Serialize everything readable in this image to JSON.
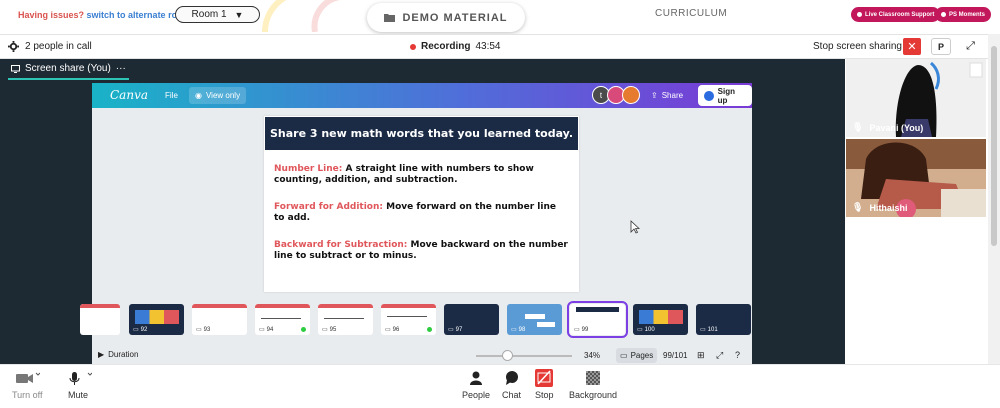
{
  "topbar": {
    "issues_text": "Having issues?",
    "alt_room_link": "switch to alternate room",
    "room_select": "Room 1",
    "demo_material": "DEMO MATERIAL",
    "curriculum": "CURRICULUM",
    "live_support": "Live Classroom Support",
    "ps_moments": "PS Moments",
    "brand_color": "#c2185b"
  },
  "callbar": {
    "people_count": "2 people in call",
    "recording_label": "Recording",
    "recording_time": "43:54",
    "stop_sharing": "Stop screen sharing",
    "p_label": "P"
  },
  "stage": {
    "share_tab": "Screen share (You)",
    "more": "···"
  },
  "canva": {
    "logo": "Canva",
    "file": "File",
    "view_only": "View only",
    "avatar_initial": "t",
    "share": "Share",
    "sign_up": "Sign up",
    "slide": {
      "title": "Share 3 new math words that you learned today.",
      "items": [
        {
          "term": "Number Line:",
          "text": "A straight line with numbers to show counting, addition, and subtraction."
        },
        {
          "term": "Forward for Addition:",
          "text": "Move forward on the number line to add."
        },
        {
          "term": "Backward for Subtraction:",
          "text": "Move backward on the number line to subtract or to minus."
        }
      ]
    },
    "thumbnails": [
      "92",
      "93",
      "94",
      "95",
      "96",
      "97",
      "98",
      "99",
      "100",
      "101"
    ],
    "selected_thumbnail": "99",
    "duration": "Duration",
    "zoom": "34%",
    "pages": "Pages",
    "page_count": "99/101"
  },
  "participants": [
    {
      "name": "Pavani (You)"
    },
    {
      "name": "Hithaishi"
    }
  ],
  "controls": {
    "turn_off": "Turn off",
    "mute": "Mute",
    "people": "People",
    "chat": "Chat",
    "stop": "Stop",
    "background": "Background"
  }
}
